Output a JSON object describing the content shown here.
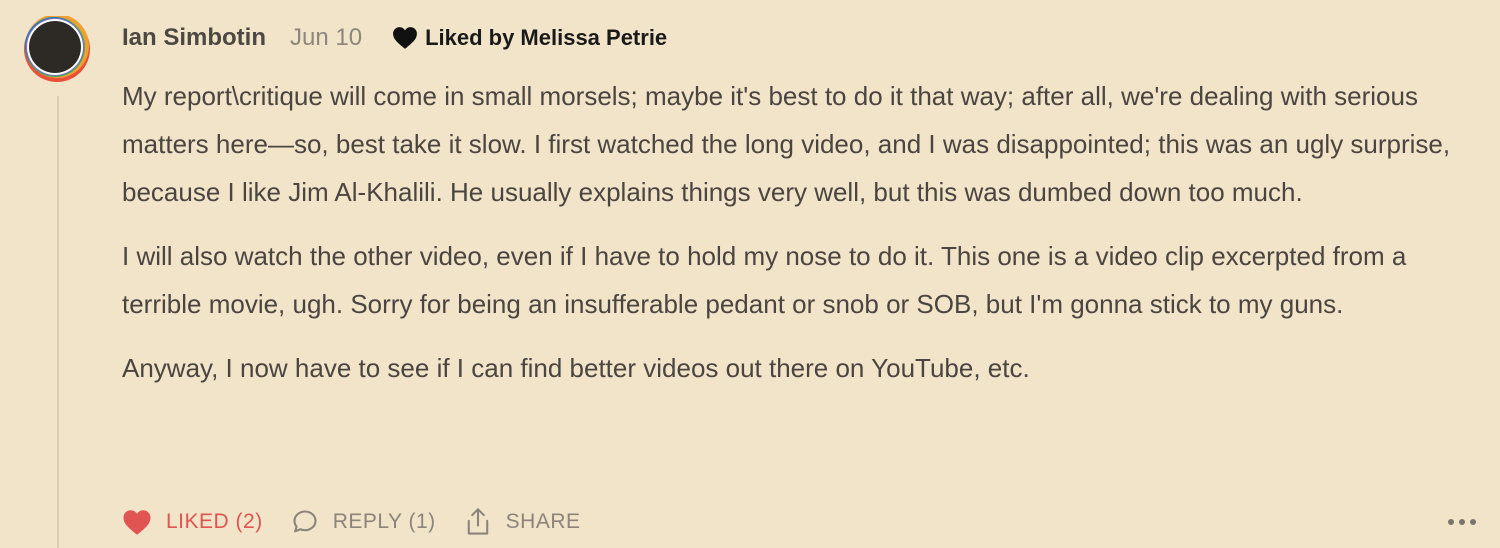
{
  "comment": {
    "author": "Ian Simbotin",
    "date": "Jun 10",
    "liked_by": "Liked by Melissa Petrie",
    "paragraphs": [
      "My report\\critique will come in small morsels; maybe it's best to do it that way; after all, we're dealing with serious matters here—so, best take it slow. I first watched the long video, and I was disappointed; this was an ugly surprise, because I like Jim Al-Khalili. He usually explains things very well, but this was dumbed down too much.",
      "I will also watch the other video, even if I have to hold my nose to do it. This one is a video clip excerpted from a terrible movie, ugh. Sorry for being an insufferable pedant or snob or SOB, but I'm gonna stick to my guns.",
      "Anyway, I now have to see if I can find better videos out there on YouTube, etc."
    ],
    "actions": {
      "like_label": "LIKED (2)",
      "reply_label": "REPLY (1)",
      "share_label": "SHARE"
    }
  },
  "icons": {
    "liked_by": "heart-icon",
    "like": "heart-filled-icon",
    "reply": "speech-bubble-icon",
    "share": "share-icon",
    "more": "more-horizontal-icon"
  },
  "colors": {
    "background": "#f2e4c9",
    "liked_accent": "#e05552",
    "text": "#4a4540",
    "muted": "#8a847b"
  }
}
